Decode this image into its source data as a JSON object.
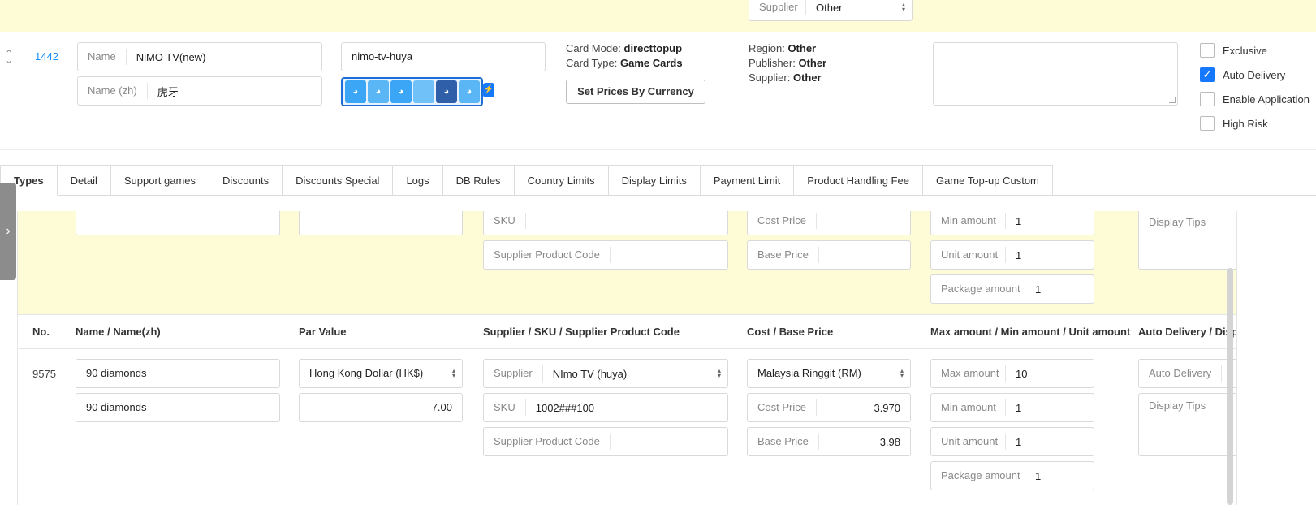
{
  "topbar": {
    "supplier_label": "Supplier",
    "supplier_value": "Other"
  },
  "product": {
    "id": "1442",
    "name_label": "Name",
    "name_value": "NiMO TV(new)",
    "name_zh_label": "Name (zh)",
    "name_zh_value": "虎牙",
    "slug": "nimo-tv-huya",
    "card_mode_label": "Card Mode:",
    "card_mode_value": "directtopup",
    "card_type_label": "Card Type:",
    "card_type_value": "Game Cards",
    "set_prices_button": "Set Prices By Currency",
    "region_label": "Region:",
    "region_value": "Other",
    "publisher_label": "Publisher:",
    "publisher_value": "Other",
    "supplier_label": "Supplier:",
    "supplier_value": "Other",
    "checkboxes": [
      {
        "label": "Exclusive",
        "checked": false
      },
      {
        "label": "Auto Delivery",
        "checked": true
      },
      {
        "label": "Enable Application",
        "checked": false
      },
      {
        "label": "High Risk",
        "checked": false
      }
    ]
  },
  "tabs": [
    "Types",
    "Detail",
    "Support games",
    "Discounts",
    "Discounts Special",
    "Logs",
    "DB Rules",
    "Country Limits",
    "Display Limits",
    "Payment Limit",
    "Product Handling Fee",
    "Game Top-up Custom"
  ],
  "new_row": {
    "sku_label": "SKU",
    "supplier_code_label": "Supplier Product Code",
    "cost_label": "Cost Price",
    "base_label": "Base Price",
    "min_label": "Min amount",
    "min_value": "1",
    "unit_label": "Unit amount",
    "unit_value": "1",
    "package_label": "Package amount",
    "package_value": "1",
    "display_tips_placeholder": "Display Tips"
  },
  "columns": [
    "No.",
    "Name / Name(zh)",
    "Par Value",
    "Supplier / SKU / Supplier Product Code",
    "Cost / Base Price",
    "Max amount / Min amount / Unit amount",
    "Auto Delivery / Disp"
  ],
  "row": {
    "no": "9575",
    "name": "90 diamonds",
    "name_zh": "90 diamonds",
    "par_currency": "Hong Kong Dollar (HK$)",
    "par_value": "7.00",
    "supplier_label": "Supplier",
    "supplier_value": "NImo TV (huya)",
    "sku_label": "SKU",
    "sku_value": "1002###100",
    "supplier_code_label": "Supplier Product Code",
    "cost_currency": "Malaysia Ringgit (RM)",
    "cost_label": "Cost Price",
    "cost_value": "3.970",
    "base_label": "Base Price",
    "base_value": "3.98",
    "max_label": "Max amount",
    "max_value": "10",
    "min_label": "Min amount",
    "min_value": "1",
    "unit_label": "Unit amount",
    "unit_value": "1",
    "package_label": "Package amount",
    "package_value": "1",
    "auto_delivery_label": "Auto Delivery",
    "display_tips_placeholder": "Display Tips"
  }
}
